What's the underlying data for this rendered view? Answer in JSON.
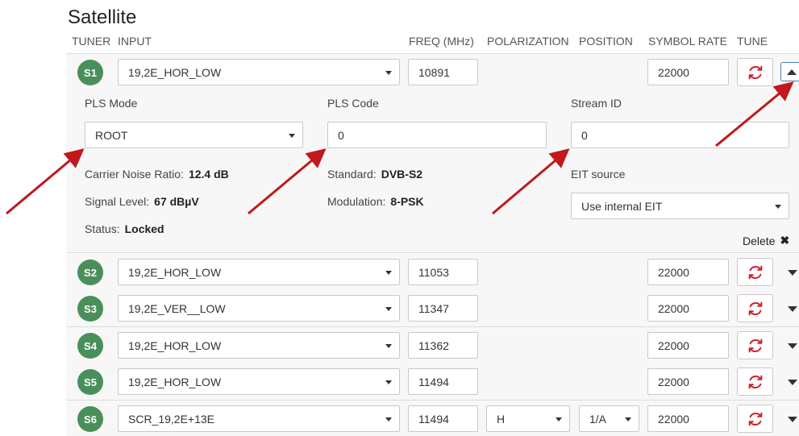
{
  "title": "Satellite",
  "headers": {
    "tuner": "TUNER",
    "input": "INPUT",
    "freq": "FREQ (MHz)",
    "polarization": "POLARIZATION",
    "position": "POSITION",
    "symbol_rate": "SYMBOL RATE",
    "tune": "TUNE"
  },
  "expanded": {
    "tuner": "S1",
    "input": "19,2E_HOR_LOW",
    "freq": "10891",
    "symbol_rate": "22000",
    "pls_mode_label": "PLS Mode",
    "pls_mode_value": "ROOT",
    "pls_code_label": "PLS Code",
    "pls_code_value": "0",
    "stream_id_label": "Stream ID",
    "stream_id_value": "0",
    "cnr_label": "Carrier Noise Ratio:",
    "cnr_value": "12.4 dB",
    "signal_label": "Signal Level:",
    "signal_value": "67 dBµV",
    "status_label": "Status:",
    "status_value": "Locked",
    "standard_label": "Standard:",
    "standard_value": "DVB-S2",
    "modulation_label": "Modulation:",
    "modulation_value": "8-PSK",
    "eit_label": "EIT source",
    "eit_value": "Use internal EIT",
    "delete_label": "Delete"
  },
  "rows": [
    {
      "tuner": "S2",
      "input": "19,2E_HOR_LOW",
      "freq": "11053",
      "symbol_rate": "22000"
    },
    {
      "tuner": "S3",
      "input": "19,2E_VER__LOW",
      "freq": "11347",
      "symbol_rate": "22000"
    },
    {
      "tuner": "S4",
      "input": "19,2E_HOR_LOW",
      "freq": "11362",
      "symbol_rate": "22000"
    },
    {
      "tuner": "S5",
      "input": "19,2E_HOR_LOW",
      "freq": "11494",
      "symbol_rate": "22000"
    },
    {
      "tuner": "S6",
      "input": "SCR_19,2E+13E",
      "freq": "11494",
      "polarization": "H",
      "position": "1/A",
      "symbol_rate": "22000"
    }
  ],
  "colors": {
    "badge": "#4a8f5a",
    "tune_icon": "#d0202a",
    "annotation_arrow": "#c0181c"
  },
  "icons": {
    "tune": "refresh-icon",
    "expand": "caret-down-icon",
    "collapse": "caret-up-icon",
    "delete": "close-icon"
  }
}
